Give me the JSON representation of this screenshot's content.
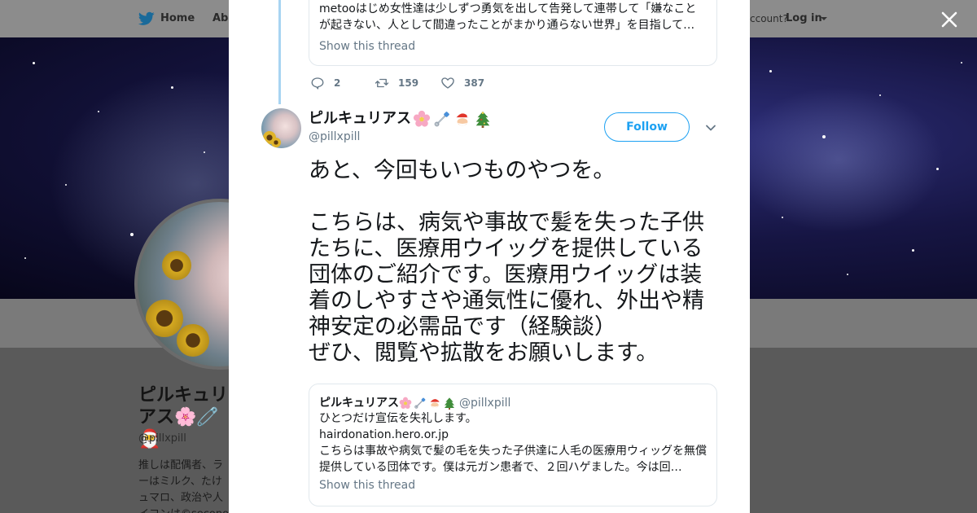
{
  "nav": {
    "home": "Home",
    "about": "Abo",
    "account_text": "ccount?",
    "login": "Log in"
  },
  "profile_bg": {
    "name": "ピルキュリアス🌸🧷🎅",
    "handle": "@pillxpill",
    "bio": "推しは配偶者、ラーはミルク、たけュマロ、政治や人イコンは©secono"
  },
  "thread": {
    "prev_quote_text": "metooはじめ女性達は少しずつ勇気を出して告発して連帯して「嫌なことが起きない、人として間違ったことがまかり通らない世界」を目指して…",
    "show_thread": "Show this thread",
    "replies": "2",
    "retweets": "159",
    "likes": "387"
  },
  "tweet": {
    "display_name": "ピルキュリアス",
    "handle": "@pillxpill",
    "follow_label": "Follow",
    "text": "あと、今回もいつものやつを。\n\nこちらは、病気や事故で髪を失った子供たちに、医療用ウイッグを提供している団体のご紹介です。医療用ウイッグは装着のしやすさや通気性に優れ、外出や精神安定の必需品です（経験談）\nぜひ、閲覧や拡散をお願いします。"
  },
  "quoted": {
    "name": "ピルキュリアス",
    "handle": "@pillxpill",
    "line1": "ひとつだけ宣伝を失礼します。",
    "line2": "hairdonation.hero.or.jp",
    "line3": "こちらは事故や病気で髪の毛を失った子供達に人毛の医療用ウィッグを無償提供している団体です。僕は元ガン患者で、２回ハゲました。今は回…",
    "show_thread": "Show this thread"
  },
  "icons": {
    "emojis": [
      "cherry-blossom-icon",
      "safety-pin-icon",
      "santa-icon",
      "christmas-tree-icon"
    ]
  },
  "colors": {
    "twitter_blue": "#1da1f2",
    "thread_line": "#a8d4f2",
    "muted_text": "#657786"
  }
}
